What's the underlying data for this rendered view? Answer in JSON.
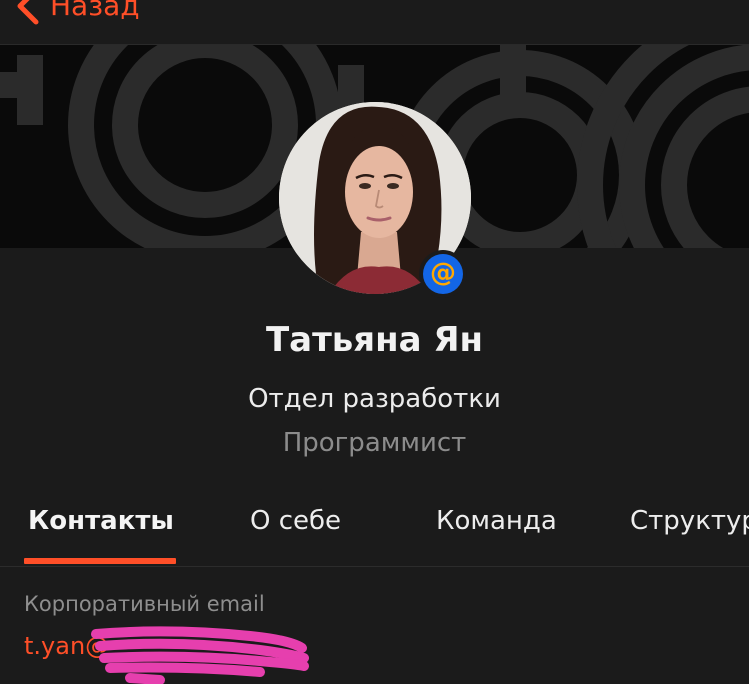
{
  "colors": {
    "accent": "#ff4f28",
    "background": "#1b1b1b",
    "cover": "#0a0a0a",
    "badge": "#1366e6",
    "badge_glyph": "#ffa800",
    "redaction": "#e63fae"
  },
  "nav": {
    "back_label": "Назад",
    "back_icon": "chevron-left-icon"
  },
  "profile": {
    "name": "Татьяна Ян",
    "department": "Отдел разработки",
    "position": "Программист",
    "badge_icon": "at-sign-icon",
    "badge_text": "@"
  },
  "tabs": [
    {
      "label": "Контакты",
      "active": true
    },
    {
      "label": "О себе",
      "active": false
    },
    {
      "label": "Команда",
      "active": false
    },
    {
      "label": "Структура",
      "active": false
    }
  ],
  "contacts": {
    "email_label": "Корпоративный email",
    "email_value": "t.yan@"
  }
}
